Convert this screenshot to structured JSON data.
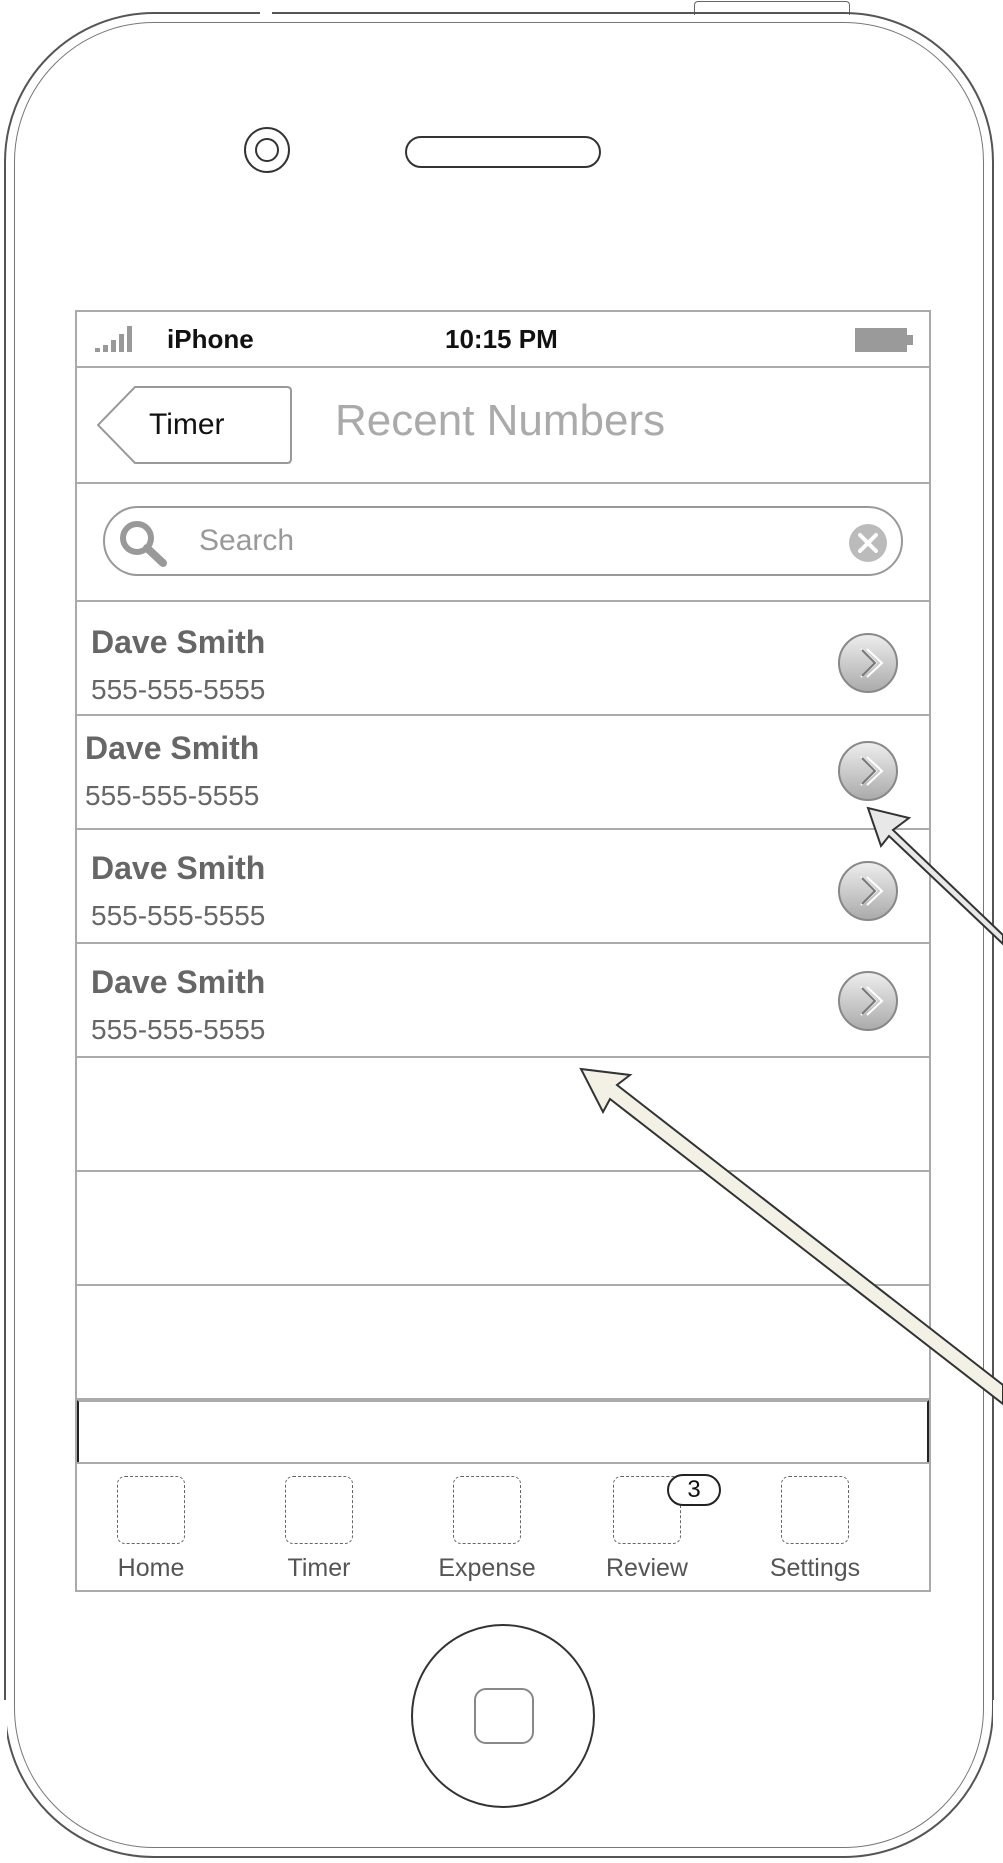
{
  "status_bar": {
    "carrier": "iPhone",
    "time": "10:15 PM"
  },
  "nav": {
    "back_label": "Timer",
    "title": "Recent Numbers"
  },
  "search": {
    "placeholder": "Search"
  },
  "contacts": [
    {
      "name": "Dave Smith",
      "phone": "555-555-5555"
    },
    {
      "name": "Dave Smith",
      "phone": "555-555-5555"
    },
    {
      "name": "Dave Smith",
      "phone": "555-555-5555"
    },
    {
      "name": "Dave Smith",
      "phone": "555-555-5555"
    }
  ],
  "tabs": [
    {
      "label": "Home"
    },
    {
      "label": "Timer"
    },
    {
      "label": "Expense"
    },
    {
      "label": "Review",
      "badge": "3"
    },
    {
      "label": "Settings"
    }
  ],
  "colors": {
    "outline": "#555555",
    "screen_border": "#aaaaaa",
    "title_gray": "#aaaaaa",
    "arrow_fill": "#f3f1e6"
  }
}
